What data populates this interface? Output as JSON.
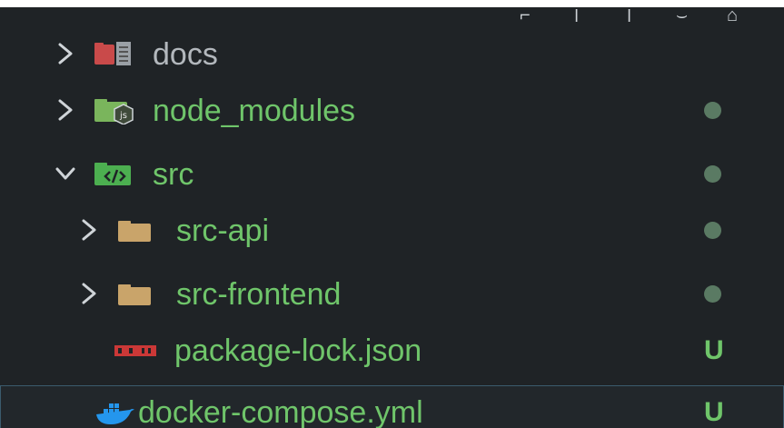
{
  "explorer": {
    "items": [
      {
        "name": "docs",
        "type": "folder",
        "icon": "docs-folder-icon",
        "expanded": false,
        "depth": 0,
        "color": "#b3b8bd",
        "status": "",
        "status_type": "none"
      },
      {
        "name": "node_modules",
        "type": "folder",
        "icon": "node-folder-icon",
        "expanded": false,
        "depth": 0,
        "color": "#6fc56a",
        "status": "",
        "status_type": "dot"
      },
      {
        "name": "src",
        "type": "folder",
        "icon": "src-folder-icon",
        "expanded": true,
        "depth": 0,
        "color": "#6fc56a",
        "status": "",
        "status_type": "dot"
      },
      {
        "name": "src-api",
        "type": "folder",
        "icon": "folder-icon",
        "expanded": false,
        "depth": 1,
        "color": "#6fc56a",
        "status": "",
        "status_type": "dot"
      },
      {
        "name": "src-frontend",
        "type": "folder",
        "icon": "folder-icon",
        "expanded": false,
        "depth": 1,
        "color": "#6fc56a",
        "status": "",
        "status_type": "dot"
      },
      {
        "name": "package-lock.json",
        "type": "file",
        "icon": "npm-icon",
        "depth": 1,
        "color": "#6fc56a",
        "status": "U",
        "status_type": "untracked"
      },
      {
        "name": "docker-compose.yml",
        "type": "file",
        "icon": "docker-icon",
        "depth": 0,
        "color": "#6fc56a",
        "status": "U",
        "status_type": "untracked",
        "selected": true
      }
    ]
  },
  "colors": {
    "background": "#1f2326",
    "untracked": "#6fc56a",
    "dot": "#5a7a63",
    "chevron": "#cfd4d8",
    "folder_tan": "#c9a46a",
    "docs_red": "#c94a4a",
    "node_green": "#7ab55c",
    "src_green": "#4caf50",
    "npm_red": "#cb3837",
    "docker_blue": "#2496ed"
  }
}
